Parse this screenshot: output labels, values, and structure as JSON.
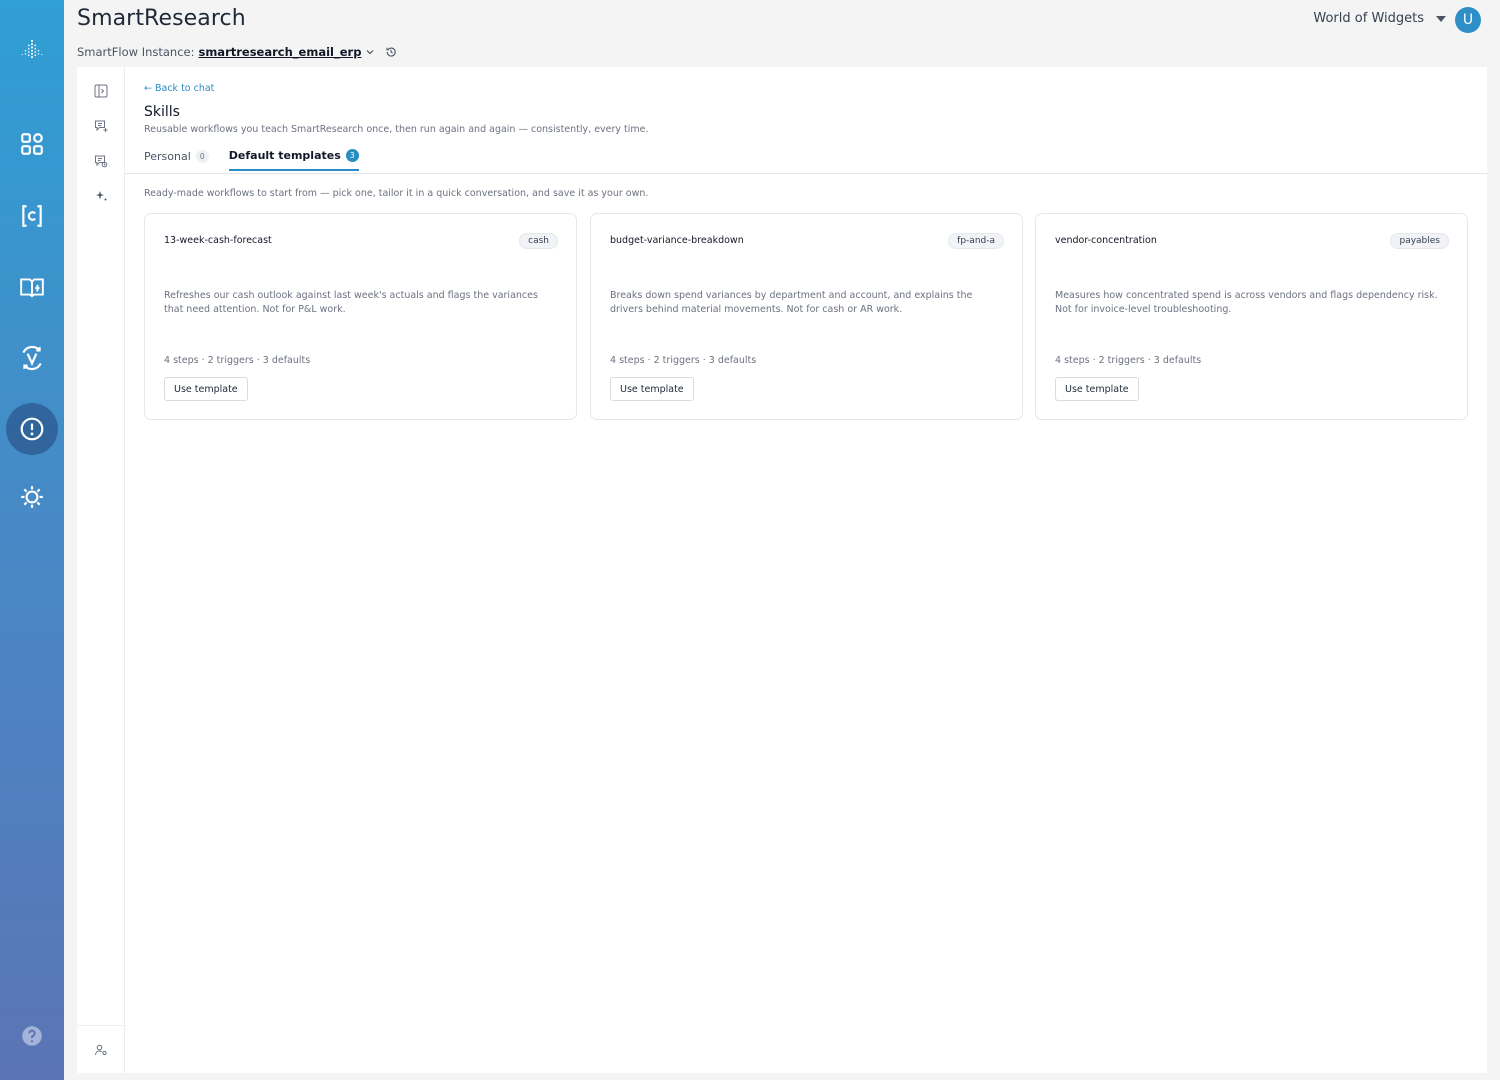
{
  "app": {
    "title": "SmartResearch",
    "instance_label": "SmartFlow Instance:",
    "instance_name": "smartresearch_email_erp",
    "org_name": "World of Widgets",
    "user_initial": "U"
  },
  "rail": {
    "items": [
      "logo-icon",
      "dashboard-icon",
      "smartcube-icon",
      "data-book-icon",
      "validation-icon",
      "alert-icon",
      "settings-icon",
      "help-icon"
    ],
    "active": "alert-icon"
  },
  "subrail": {
    "items": [
      "toggle-panel-icon",
      "new-chat-icon",
      "chat-history-icon",
      "skills-sparkle-icon",
      "user-settings-icon"
    ]
  },
  "page": {
    "back_link": "← Back to chat",
    "title": "Skills",
    "subtitle": "Reusable workflows you teach SmartResearch once, then run again and again — consistently, every time.",
    "tabs": [
      {
        "label": "Personal",
        "count": "0",
        "active": false
      },
      {
        "label": "Default templates",
        "count": "3",
        "active": true
      }
    ],
    "intro": "Ready-made workflows to start from — pick one, tailor it in a quick conversation, and save it as your own."
  },
  "templates": [
    {
      "name": "13-week-cash-forecast",
      "tag": "cash",
      "description": "Refreshes our cash outlook against last week's actuals and flags the variances that need attention. Not for P&L work.",
      "meta": "4 steps · 2 triggers · 3 defaults",
      "button": "Use template"
    },
    {
      "name": "budget-variance-breakdown",
      "tag": "fp-and-a",
      "description": "Breaks down spend variances by department and account, and explains the drivers behind material movements. Not for cash or AR work.",
      "meta": "4 steps · 2 triggers · 3 defaults",
      "button": "Use template"
    },
    {
      "name": "vendor-concentration",
      "tag": "payables",
      "description": "Measures how concentrated spend is across vendors and flags dependency risk. Not for invoice-level troubleshooting.",
      "meta": "4 steps · 2 triggers · 3 defaults",
      "button": "Use template"
    }
  ],
  "colors": {
    "accent": "#2a8cc4",
    "rail_top": "#2f9fd4",
    "rail_bottom": "#5b74b5"
  }
}
